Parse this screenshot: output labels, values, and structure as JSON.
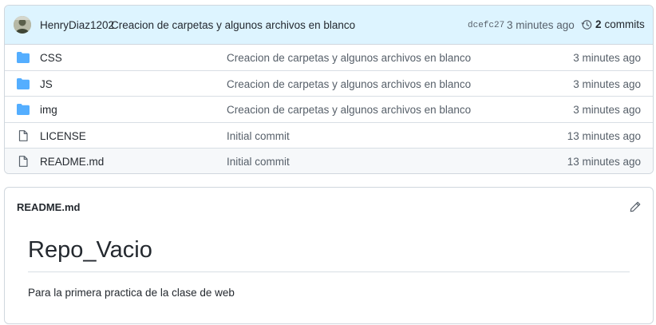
{
  "commit": {
    "author": "HenryDiaz1202",
    "message": "Creacion de carpetas y algunos archivos en blanco",
    "hash": "dcefc27",
    "time": "3 minutes ago",
    "commit_count": "2",
    "commits_label": "commits"
  },
  "files": [
    {
      "type": "folder",
      "name": "CSS",
      "message": "Creacion de carpetas y algunos archivos en blanco",
      "time": "3 minutes ago"
    },
    {
      "type": "folder",
      "name": "JS",
      "message": "Creacion de carpetas y algunos archivos en blanco",
      "time": "3 minutes ago"
    },
    {
      "type": "folder",
      "name": "img",
      "message": "Creacion de carpetas y algunos archivos en blanco",
      "time": "3 minutes ago"
    },
    {
      "type": "file",
      "name": "LICENSE",
      "message": "Initial commit",
      "time": "13 minutes ago"
    },
    {
      "type": "file",
      "name": "README.md",
      "message": "Initial commit",
      "time": "13 minutes ago"
    }
  ],
  "readme": {
    "filename": "README.md",
    "heading": "Repo_Vacio",
    "paragraph": "Para la primera practica de la clase de web"
  },
  "colors": {
    "folder": "#54aeff",
    "commit_bar": "#ddf4ff",
    "border": "#d0d7de"
  }
}
